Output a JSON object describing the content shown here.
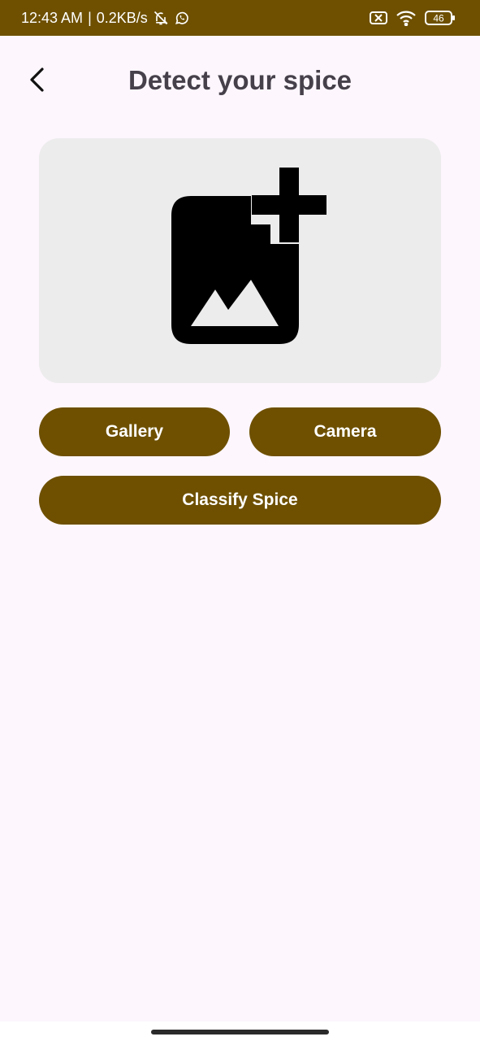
{
  "status_bar": {
    "time": "12:43 AM",
    "separator": "|",
    "speed": "0.2KB/s",
    "battery": "46",
    "icons": [
      "bell-off-icon",
      "whatsapp-icon",
      "sim-blocked-icon",
      "wifi-icon",
      "battery-icon"
    ]
  },
  "header": {
    "back_icon": "back-arrow-icon",
    "title": "Detect your spice"
  },
  "image_picker": {
    "icon": "add-photo-icon"
  },
  "buttons": {
    "gallery": "Gallery",
    "camera": "Camera",
    "classify": "Classify Spice"
  },
  "colors": {
    "primary": "#6e5000",
    "background": "#fdf6fd",
    "image_box": "#ececec",
    "title_text": "#45404a"
  }
}
